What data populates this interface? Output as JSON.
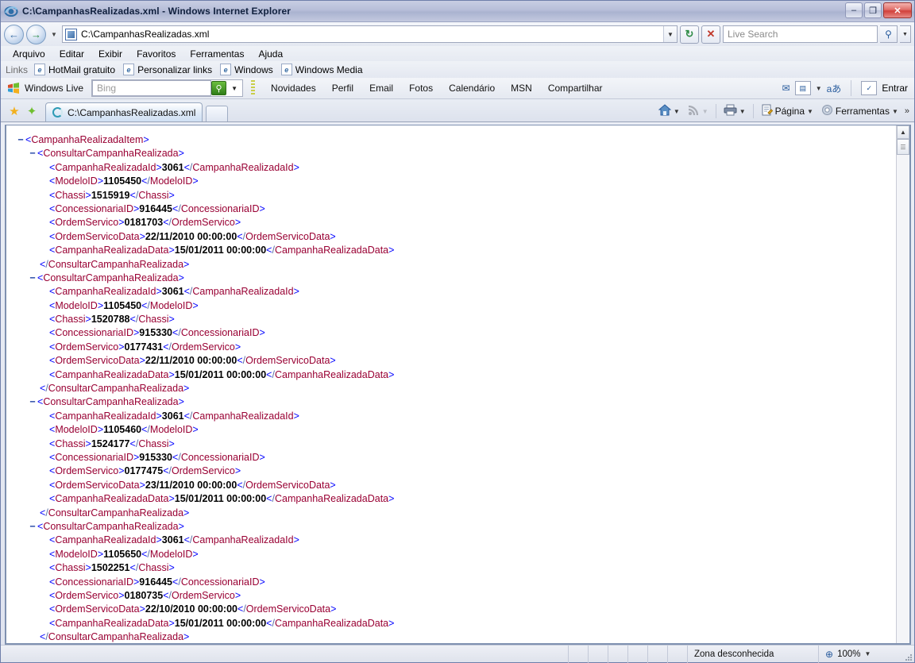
{
  "window": {
    "title": "C:\\CampanhasRealizadas.xml - Windows Internet Explorer",
    "minimize_label": "–",
    "restore_label": "❐",
    "close_label": "✕"
  },
  "address_bar": {
    "back_label": "←",
    "forward_label": "→",
    "history_caret": "▼",
    "url": "C:\\CampanhasRealizadas.xml",
    "url_dropdown_caret": "▼",
    "refresh_label": "↻",
    "stop_label": "✕",
    "search_placeholder": "Live Search",
    "search_go": "⚲",
    "search_options_caret": "▼"
  },
  "menu": {
    "items": [
      "Arquivo",
      "Editar",
      "Exibir",
      "Favoritos",
      "Ferramentas",
      "Ajuda"
    ]
  },
  "links_bar": {
    "label": "Links",
    "items": [
      "HotMail gratuito",
      "Personalizar links",
      "Windows",
      "Windows Media"
    ]
  },
  "windows_live": {
    "title": "Windows Live",
    "search_placeholder": "Bing",
    "search_go": "⚲",
    "search_caret": "▼",
    "links": [
      "Novidades",
      "Perfil",
      "Email",
      "Fotos",
      "Calendário",
      "MSN",
      "Compartilhar"
    ],
    "mail_icon": "✉",
    "toolbar_icon": "▤",
    "toolbar_caret": "▼",
    "translate_icon": "aあ",
    "signin_icon": "✓",
    "signin_label": "Entrar"
  },
  "tabs": {
    "favorites_star": "★",
    "add_favorites": "✦",
    "items": [
      {
        "label": "C:\\CampanhasRealizadas.xml",
        "active": true
      }
    ],
    "new_tab_label": ""
  },
  "command_bar": {
    "home_label": "",
    "home_caret": "▼",
    "feeds_label": "",
    "feeds_caret": "▼",
    "print_label": "",
    "print_caret": "▼",
    "page_label": "Página",
    "page_caret": "▼",
    "tools_label": "Ferramentas",
    "tools_caret": "▼",
    "overflow": "»"
  },
  "scrollbar": {
    "up_arrow": "▲",
    "down_arrow": "▼",
    "thumb_grip": "☰"
  },
  "status_bar": {
    "left_text": "",
    "zone": "Zona desconhecida",
    "zoom_icon": "⊕",
    "zoom_level": "100%",
    "zoom_caret": "▼"
  },
  "xml": {
    "root_open": "CampanhaRealizadaItem",
    "record_tag": "ConsultarCampanhaRealizada",
    "fields": [
      "CampanhaRealizadaId",
      "ModeloID",
      "Chassi",
      "ConcessionariaID",
      "OrdemServico",
      "OrdemServicoData",
      "CampanhaRealizadaData"
    ],
    "records": [
      {
        "CampanhaRealizadaId": "3061",
        "ModeloID": "1105450",
        "Chassi": "1515919",
        "ConcessionariaID": "916445",
        "OrdemServico": "0181703",
        "OrdemServicoData": "22/11/2010 00:00:00",
        "CampanhaRealizadaData": "15/01/2011 00:00:00"
      },
      {
        "CampanhaRealizadaId": "3061",
        "ModeloID": "1105450",
        "Chassi": "1520788",
        "ConcessionariaID": "915330",
        "OrdemServico": "0177431",
        "OrdemServicoData": "22/11/2010 00:00:00",
        "CampanhaRealizadaData": "15/01/2011 00:00:00"
      },
      {
        "CampanhaRealizadaId": "3061",
        "ModeloID": "1105460",
        "Chassi": "1524177",
        "ConcessionariaID": "915330",
        "OrdemServico": "0177475",
        "OrdemServicoData": "23/11/2010 00:00:00",
        "CampanhaRealizadaData": "15/01/2011 00:00:00"
      },
      {
        "CampanhaRealizadaId": "3061",
        "ModeloID": "1105650",
        "Chassi": "1502251",
        "ConcessionariaID": "916445",
        "OrdemServico": "0180735",
        "OrdemServicoData": "22/10/2010 00:00:00",
        "CampanhaRealizadaData": "15/01/2011 00:00:00"
      }
    ]
  }
}
